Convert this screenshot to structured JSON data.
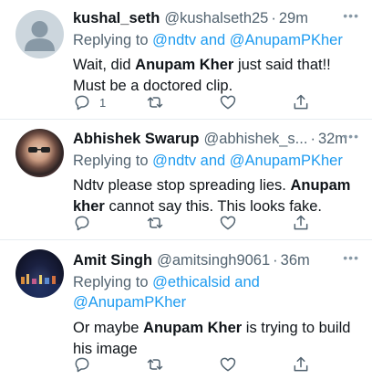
{
  "tweets": [
    {
      "name": "kushal_seth",
      "handle": "@kushalseth25",
      "dot": "·",
      "time": "29m",
      "more": "•••",
      "reply_prefix": "Replying to ",
      "reply_link1": "@ndtv and @AnupamPKher",
      "reply_link2": "",
      "avatar_icon": "default-profile-icon",
      "text_parts": [
        {
          "t": "Wait, did ",
          "bold": false
        },
        {
          "t": "Anupam Kher",
          "bold": true
        },
        {
          "t": " just said that!! Must be a doctored clip.",
          "bold": false
        }
      ],
      "reply_count": "1"
    },
    {
      "name": "Abhishek Swarup",
      "handle": "@abhishek_s...",
      "dot": "·",
      "time": "32m",
      "more": "•••",
      "reply_prefix": "Replying to ",
      "reply_link1": "@ndtv and @AnupamPKher",
      "reply_link2": "",
      "avatar_icon": "profile-photo",
      "text_parts": [
        {
          "t": "Ndtv please stop spreading lies. ",
          "bold": false
        },
        {
          "t": "Anupam kher",
          "bold": true
        },
        {
          "t": " cannot say this. This looks fake.",
          "bold": false
        }
      ],
      "reply_count": ""
    },
    {
      "name": "Amit Singh",
      "handle": "@amitsingh9061",
      "dot": "·",
      "time": "36m",
      "more": "•••",
      "reply_prefix": "Replying to ",
      "reply_link1": "@ethicalsid and",
      "reply_link2": "@AnupamPKher",
      "avatar_icon": "profile-photo",
      "text_parts": [
        {
          "t": "Or maybe ",
          "bold": false
        },
        {
          "t": "Anupam Kher",
          "bold": true
        },
        {
          "t": " is trying to build his image",
          "bold": false
        }
      ],
      "reply_count": ""
    }
  ],
  "icons": [
    "reply-icon",
    "retweet-icon",
    "like-icon",
    "share-icon"
  ],
  "colors": {
    "link": "#1d9bf0",
    "secondary": "#536471",
    "text": "#0f1419"
  }
}
